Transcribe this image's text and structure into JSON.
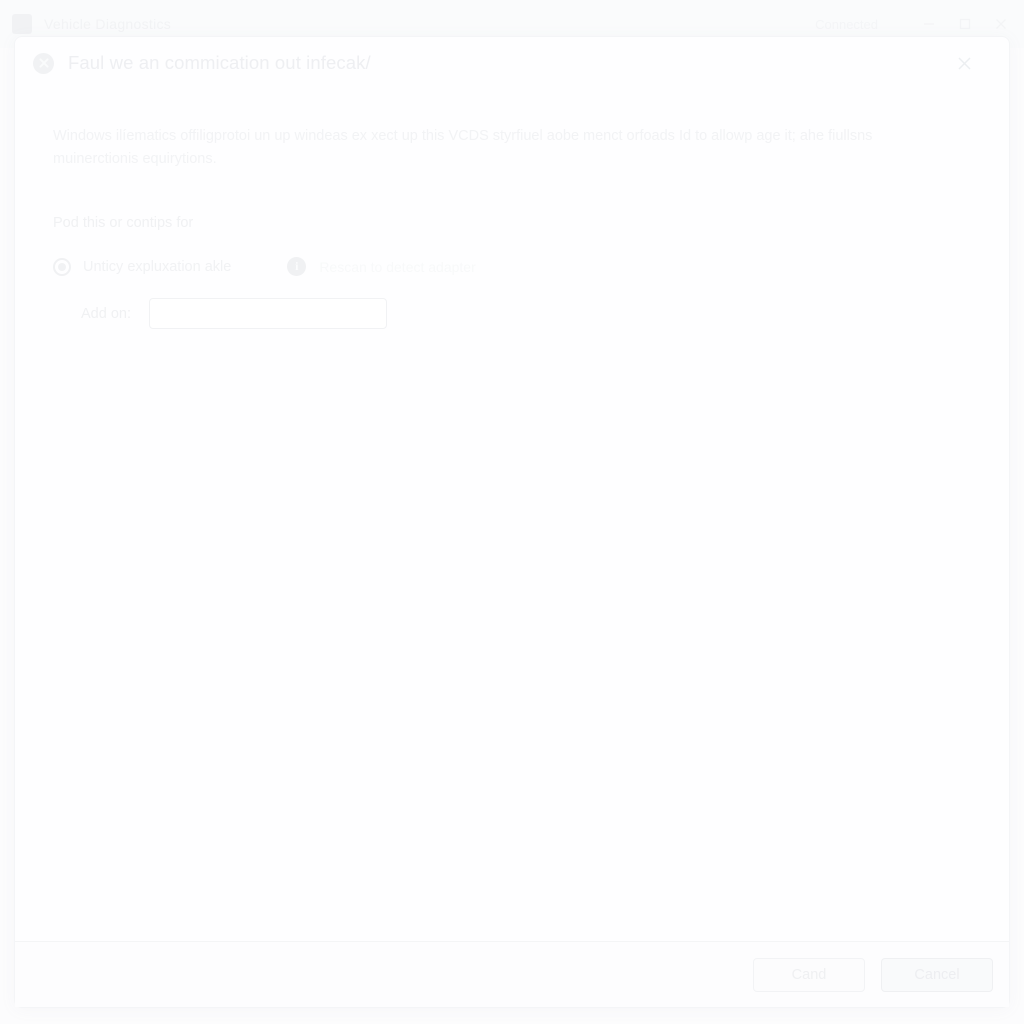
{
  "window": {
    "app_icon": "app-logo-icon",
    "title": "Vehicle Diagnostics",
    "status_text": "Connected",
    "icons": [
      "minimize-icon",
      "maximize-icon",
      "window-close-icon"
    ]
  },
  "dialog": {
    "severity_icon": "error-circle-icon",
    "title": "Faul we an commication out infecak/",
    "close_icon": "close-icon",
    "message": "Windows ilíematics offiligprotoi un up windeas ex xect up this VCDS styrfiuel aobe menct orfoads Id to allowp age it; ahe fiullsns muinerctionis equirytions.",
    "options_label": "Pod this or contips for",
    "option": {
      "label": "Unticy expluxation akle",
      "selected": true
    },
    "info": {
      "icon": "info-icon",
      "glyph": "i",
      "text": "Rescan to detect adapter"
    },
    "field": {
      "label": "Add on:",
      "value": "",
      "placeholder": ""
    },
    "footer": {
      "confirm_label": "Cand",
      "cancel_label": "Cancel"
    }
  },
  "colors": {
    "page_background": "#fbfbfc",
    "dialog_background": "#fefeff",
    "border": "#f4f5f7",
    "text_muted": "#f1f2f4"
  }
}
